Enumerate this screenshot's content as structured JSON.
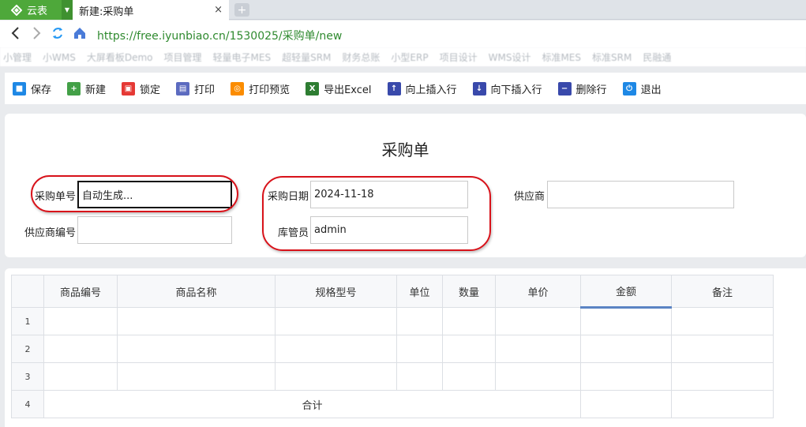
{
  "browser": {
    "brand": "云表",
    "tab_title": "新建:采购单",
    "tab_close": "×",
    "new_tab": "+",
    "url": "https://free.iyunbiao.cn/1530025/采购单/new",
    "bookmarks": [
      "小管理",
      "小WMS",
      "大屏看板Demo",
      "项目管理",
      "轻量电子MES",
      "超轻量SRM",
      "财务总账",
      "小型ERP",
      "项目设计",
      "WMS设计",
      "标准MES",
      "标准SRM",
      "民融通"
    ]
  },
  "toolbar": {
    "buttons": [
      {
        "label": "保存",
        "icon": "save-icon",
        "color": "#1e88e5"
      },
      {
        "label": "新建",
        "icon": "add-icon",
        "color": "#43a047"
      },
      {
        "label": "锁定",
        "icon": "lock-icon",
        "color": "#e53935"
      },
      {
        "label": "打印",
        "icon": "print-icon",
        "color": "#5c6bc0"
      },
      {
        "label": "打印预览",
        "icon": "print-preview-icon",
        "color": "#fb8c00"
      },
      {
        "label": "导出Excel",
        "icon": "excel-icon",
        "color": "#2e7d32"
      },
      {
        "label": "向上插入行",
        "icon": "insert-row-above-icon",
        "color": "#3949ab"
      },
      {
        "label": "向下插入行",
        "icon": "insert-row-below-icon",
        "color": "#3949ab"
      },
      {
        "label": "删除行",
        "icon": "delete-row-icon",
        "color": "#3949ab"
      },
      {
        "label": "退出",
        "icon": "power-icon",
        "color": "#1e88e5"
      }
    ]
  },
  "form": {
    "title": "采购单",
    "po_number_label": "采购单号",
    "po_number_value": "自动生成...",
    "po_date_label": "采购日期",
    "po_date_value": "2024-11-18",
    "supplier_label": "供应商",
    "supplier_value": "",
    "supplier_code_label": "供应商编号",
    "supplier_code_value": "",
    "keeper_label": "库管员",
    "keeper_value": "admin"
  },
  "grid": {
    "columns": [
      "商品编号",
      "商品名称",
      "规格型号",
      "单位",
      "数量",
      "单价",
      "金额",
      "备注"
    ],
    "row_numbers": [
      "1",
      "2",
      "3",
      "4"
    ],
    "total_label": "合计"
  }
}
